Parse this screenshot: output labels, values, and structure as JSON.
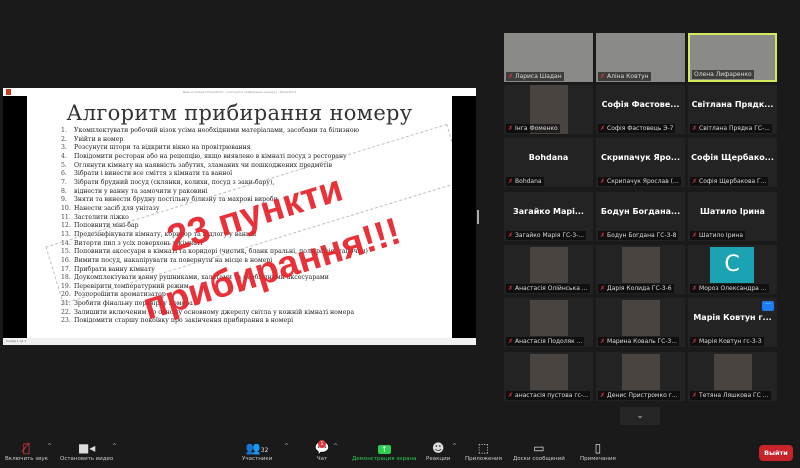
{
  "share": {
    "window_title": "Демонстрация PowerPoint - [Алгоритм прибирання номеру] - PowerPoint",
    "status": "Слайд 1 из 1",
    "slide_title": "Алгоритм прибирання номеру",
    "stamp": "23 пункти прибирання!!!",
    "items": [
      "Укомплектувати робочий візок усіма необхідними матеріалами, засобами та білизною",
      "Увійти в номер",
      "Розсунути штори та відкрити вікно на провітрювання",
      "Повідомити ресторан або на рецепцію, якщо виявлено в кімнаті посуд з ресторану",
      "Оглянути кімнату на наявність забутих, зламаних чи пошкоджених предметів",
      "Зібрати і винести все сміття з кімнати та ванної",
      "Зібрати брудний посуд (склянки, келихи, посуд з заки-бару),",
      "віднести у ванну та замочити у раковині",
      "Зняти та винести брудну постільну білизну та махрові вироби",
      "Нанести засіб для унітазу",
      "Застелити ліжко",
      "Поповнити міні-бар",
      "Продезінфікувати кімнату, коридор та підлогу у ванній",
      "Витерти пил з усіх поверхонь у кімнаті",
      "Поповнити аксесуари в кімнаті та коридорі (чистик, бланк пральні, поліграфія, тапочки)",
      "Вимити посуд, накапірувати та повернути на місце в номері",
      "Прибрати ванну кімнату",
      "Доукомплектувати ванну рушниками, халатами та необхідними аксесуарами",
      "Перевірити температурний режим",
      "Розпорошити ароматизатор",
      "Зробити фінальну перевірку номера",
      "Залишити включеним по одному основному джерелу світла у кожній кімнаті номера",
      "Повідомити старшу покоївку про закінчення прибирання в номері"
    ]
  },
  "participants": [
    {
      "tile": "",
      "name": "Лариса Шадан",
      "video": true,
      "muted": true
    },
    {
      "tile": "",
      "name": "Аліна Ковтун",
      "video": true,
      "muted": true
    },
    {
      "tile": "",
      "name": "Олена Лифаренко",
      "video": true,
      "muted": false,
      "active": true
    },
    {
      "tile": "",
      "name": "Інга Фоменко",
      "video": true,
      "muted": true
    },
    {
      "tile": "Софія Фастове...",
      "name": "Софія Фастовець Э-7",
      "muted": true
    },
    {
      "tile": "Світлана Прядк...",
      "name": "Світлана Прядка ГС-...",
      "muted": true
    },
    {
      "tile": "Bohdana",
      "name": "Bohdana",
      "muted": true
    },
    {
      "tile": "Скрипачук Яро...",
      "name": "Скрипачук Ярослав (...",
      "muted": true
    },
    {
      "tile": "Софія Щербако...",
      "name": "Софія Щербакова Г...",
      "muted": true
    },
    {
      "tile": "Загайко Марі...",
      "name": "Загайко Марія ГС-3-...",
      "muted": true
    },
    {
      "tile": "Бодун Богдана...",
      "name": "Бодун Богдана ГС-3-8",
      "muted": true
    },
    {
      "tile": "Шатило Ірина",
      "name": "Шатило Ірина",
      "muted": true
    },
    {
      "tile": "",
      "name": "Анастасія Олійнська ...",
      "video": true,
      "muted": true
    },
    {
      "tile": "",
      "name": "Дарія Колида ГС-3-6",
      "video": true,
      "muted": true
    },
    {
      "tile": "C",
      "name": "Мороз Олександра ...",
      "avatar": true,
      "muted": true
    },
    {
      "tile": "",
      "name": "Анастасія Подоляк ...",
      "video": true,
      "muted": true
    },
    {
      "tile": "",
      "name": "Марина Коваль ГС-3...",
      "video": true,
      "muted": true
    },
    {
      "tile": "Марія Ковтун г...",
      "name": "Марія Ковтун гс-3-3",
      "muted": true,
      "more": true
    },
    {
      "tile": "",
      "name": "анастасія пустова гс-...",
      "video": true,
      "muted": true
    },
    {
      "tile": "",
      "name": "Денис Пристромко г...",
      "video": true,
      "muted": true
    },
    {
      "tile": "",
      "name": "Тетяна Ляшкова ГС ...",
      "video": true,
      "muted": true
    }
  ],
  "toolbar": {
    "unmute": "Включить звук",
    "video": "Остановить видео",
    "participants": "Участники",
    "participants_count": "32",
    "chat": "Чат",
    "chat_badge": "1",
    "share": "Демонстрация экрана",
    "reactions": "Реакции",
    "apps": "Приложения",
    "whiteboard": "Доски сообщений",
    "notes": "Примечания",
    "leave": "Выйти"
  },
  "colors": {
    "accent_green": "#2ecc52",
    "leave_red": "#c8242b",
    "active_border": "#d6e85c",
    "stamp_red": "#e8202a"
  }
}
